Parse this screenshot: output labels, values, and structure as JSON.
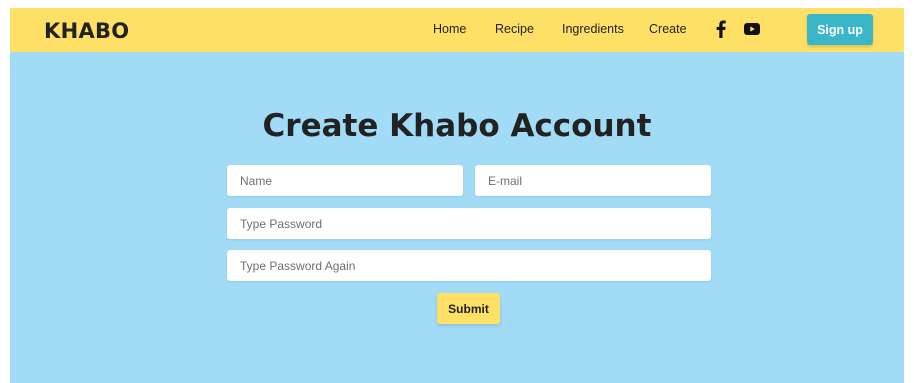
{
  "navbar": {
    "logo": "KHABO",
    "links": [
      "Home",
      "Recipe",
      "Ingredients",
      "Create"
    ],
    "social_icons": [
      "facebook-icon",
      "youtube-icon"
    ],
    "signup_label": "Sign up"
  },
  "form": {
    "title": "Create Khabo Account",
    "name_placeholder": "Name",
    "email_placeholder": "E-mail",
    "password_placeholder": "Type Password",
    "password_again_placeholder": "Type Password Again",
    "submit_label": "Submit"
  },
  "colors": {
    "navbar_bg": "#fee066",
    "content_bg": "#a1dbf6",
    "signup_button_bg": "#3bb5c8",
    "submit_button_bg": "#fee066",
    "text": "#222222"
  }
}
